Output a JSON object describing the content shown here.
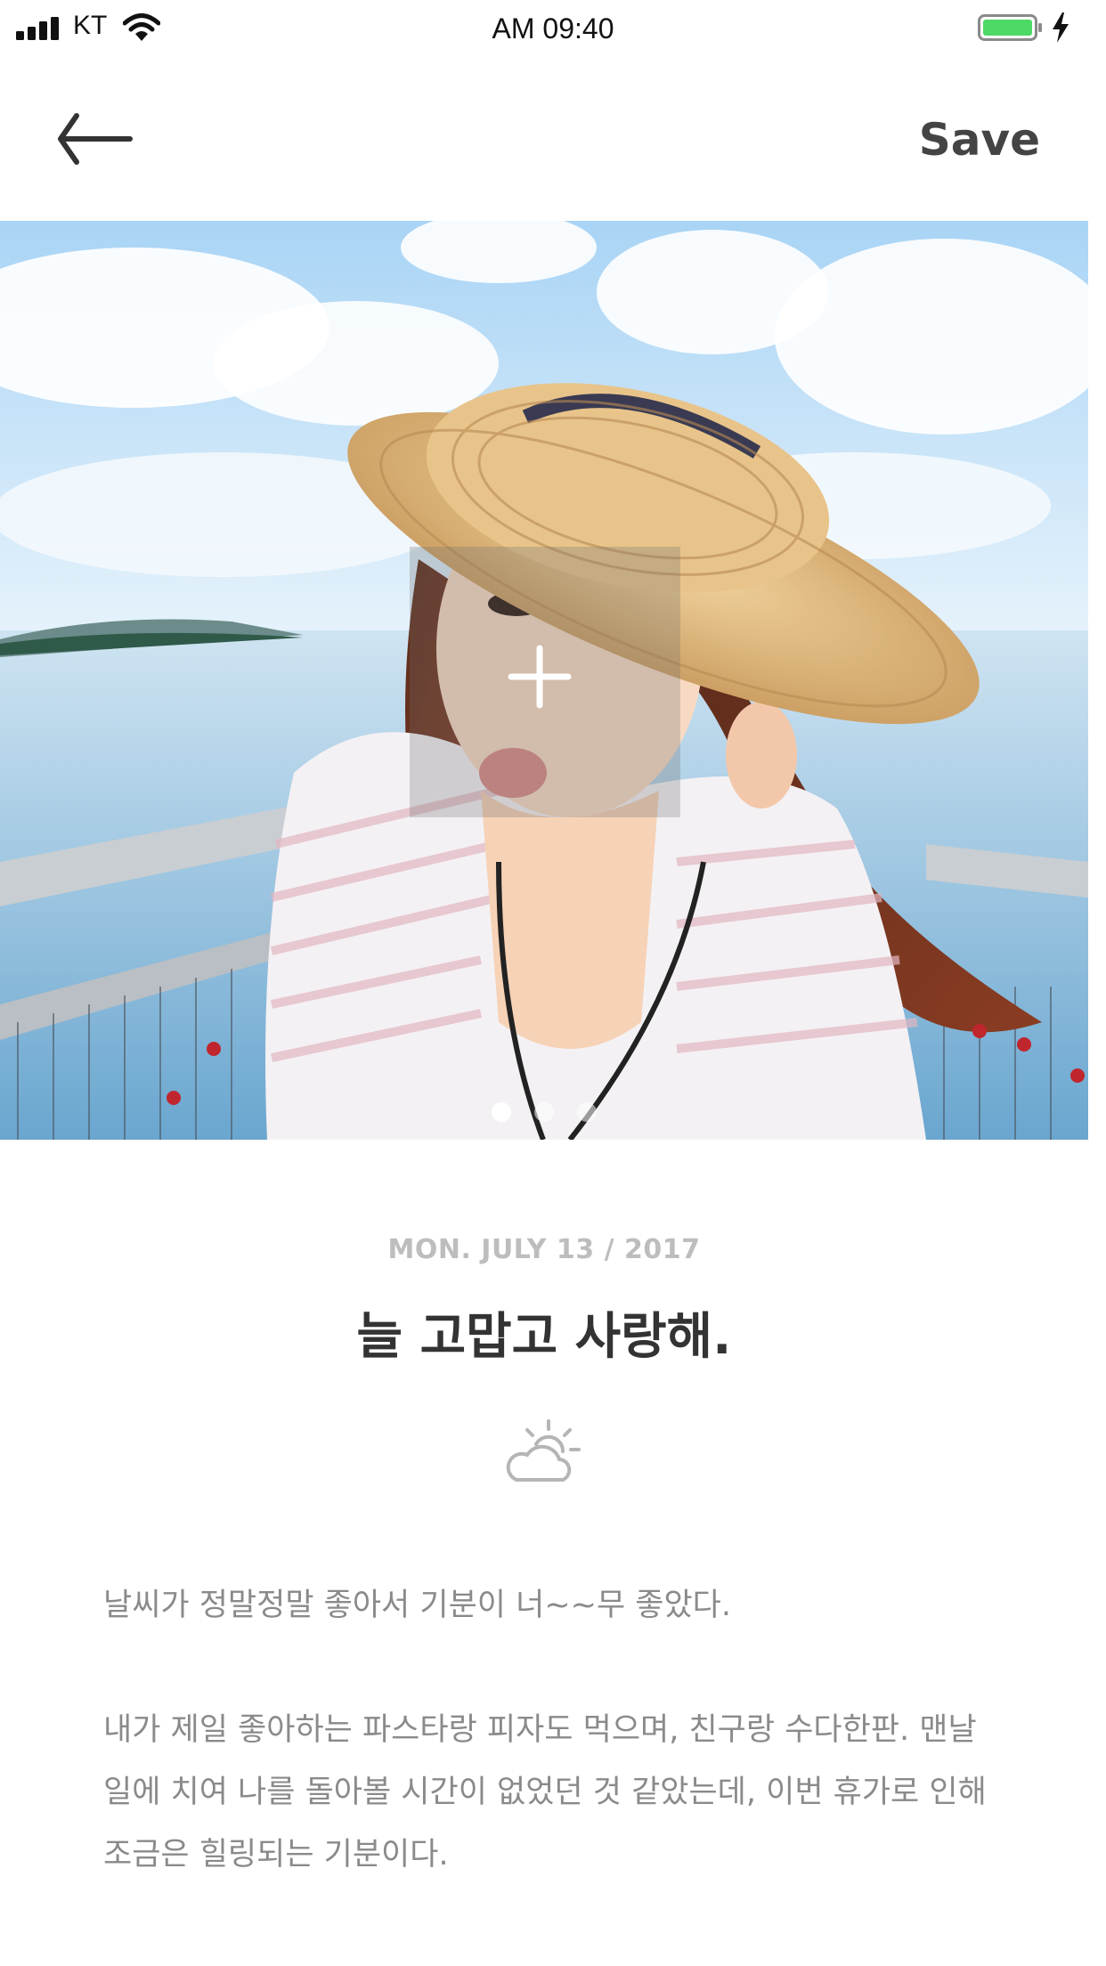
{
  "status_bar": {
    "carrier": "KT",
    "time": "AM 09:40",
    "icons": [
      "signal-icon",
      "wifi-icon",
      "battery-icon",
      "charging-icon"
    ],
    "battery_color": "#4cd964"
  },
  "nav": {
    "back_icon": "arrow-left-icon",
    "save_label": "Save"
  },
  "photo": {
    "add_icon": "plus-icon",
    "pages": 3,
    "current_page": 1
  },
  "entry": {
    "date": "MON. JULY 13 / 2017",
    "title": "늘 고맙고 사랑해.",
    "weather_icon": "partly-cloudy-icon",
    "paragraphs": [
      "날씨가 정말정말 좋아서 기분이 너~~무 좋았다.",
      "내가 제일 좋아하는 파스타랑 피자도 먹으며, 친구랑 수다한판. 맨날 일에 치여 나를 돌아볼 시간이 없었던 것 같았는데, 이번 휴가로 인해 조금은 힐링되는 기분이다."
    ]
  }
}
